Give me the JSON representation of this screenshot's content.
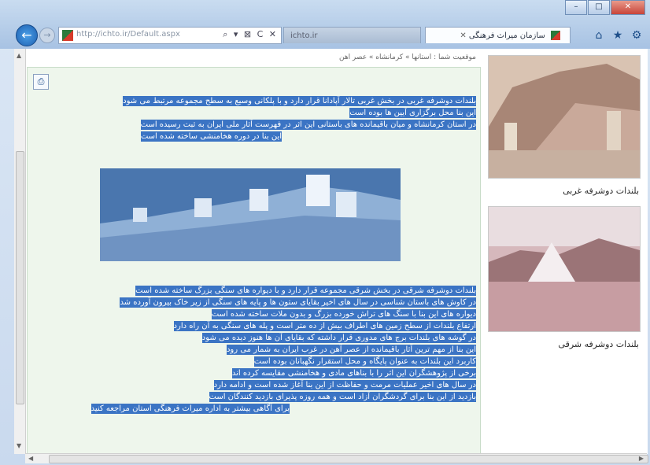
{
  "browser": {
    "url": "http://ichto.ir/Default.aspx",
    "address_icons": "⌕ ▾ ⊠ C ✕",
    "tabs": [
      {
        "label": "ichto.ir",
        "active": false
      },
      {
        "label": "سازمان میراث فرهنگی",
        "active": true
      }
    ],
    "tab_close_glyph": "✕",
    "window_controls": {
      "minimize": "–",
      "maximize": "□",
      "close": "✕"
    },
    "nav": {
      "back_glyph": "←",
      "forward_glyph": "→"
    },
    "toolbar_icons": [
      "home-icon",
      "star-icon",
      "gear-icon"
    ],
    "toolbar_glyphs": {
      "home": "⌂",
      "favorites": "★",
      "tools": "⚙"
    },
    "scroll_glyphs": {
      "up": "▲",
      "down": "▼",
      "left": "◀",
      "right": "▶"
    }
  },
  "page": {
    "breadcrumb": "موقعیت شما : استانها » کرمانشاه » عصر آهن",
    "print_glyph": "⎙",
    "sidebar": {
      "caption_1": "بلندات دوشرفه غربی",
      "caption_2": "بلندات دوشرفه شرقی"
    },
    "paragraph_1_lines": [
      "بلندات دوشرفه غربی در بخش غربی تالار آپادانا قرار دارد و با پلکانی وسیع به سطح مجموعه مرتبط می شود",
      "این بنا محل برگزاری آیین ها بوده است",
      "در استان کرمانشاه و میان باقیمانده های باستانی این اثر در فهرست آثار ملی ایران به ثبت رسیده است",
      "این بنا در دوره هخامنشی ساخته شده است"
    ],
    "paragraph_2_lines": [
      "بلندات دوشرفه شرقی در بخش شرقی مجموعه قرار دارد و با دیواره های سنگی بزرگ ساخته شده است",
      "در کاوش های باستان شناسی در سال های اخیر بقایای ستون ها و پایه های سنگی از زیر خاک بیرون آورده شد",
      "دیواره های این بنا با سنگ های تراش خورده بزرگ و بدون ملات ساخته شده است",
      "ارتفاع بلندات از سطح زمین های اطراف بیش از ده متر است و پله های سنگی به آن راه دارد",
      "در گوشه های بلندات برج های مدوری قرار داشته که بقایای آن ها هنوز دیده می شود",
      "این بنا از مهم ترین آثار باقیمانده از عصر آهن در غرب ایران به شمار می رود",
      "کاربرد این بلندات به عنوان پایگاه و محل استقرار نگهبانان بوده است",
      "برخی از پژوهشگران این اثر را با بناهای مادی و هخامنشی مقایسه کرده اند",
      "در سال های اخیر عملیات مرمت و حفاظت از این بنا آغاز شده است و ادامه دارد",
      "بازدید از این بنا برای گردشگران آزاد است و همه روزه پذیرای بازدید کنندگان است",
      "برای آگاهی بیشتر به اداره میراث فرهنگی استان مراجعه کنید"
    ]
  }
}
